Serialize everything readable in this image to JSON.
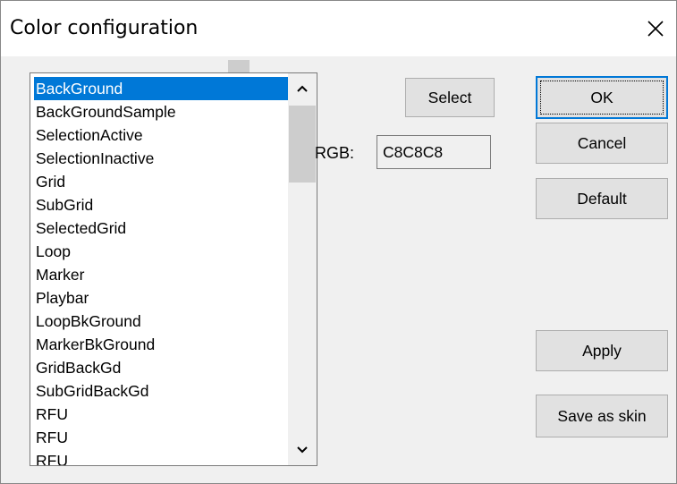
{
  "window": {
    "title": "Color configuration"
  },
  "list": {
    "items": [
      "BackGround",
      "BackGroundSample",
      "SelectionActive",
      "SelectionInactive",
      "Grid",
      "SubGrid",
      "SelectedGrid",
      "Loop",
      "Marker",
      "Playbar",
      "LoopBkGround",
      "MarkerBkGround",
      "GridBackGd",
      "SubGridBackGd",
      "RFU",
      "RFU",
      "RFU"
    ],
    "selected_index": 0
  },
  "rgb": {
    "label": "RGB:",
    "value": "C8C8C8"
  },
  "buttons": {
    "select": "Select",
    "ok": "OK",
    "cancel": "Cancel",
    "default": "Default",
    "apply": "Apply",
    "save_as_skin": "Save as skin"
  },
  "icons": {
    "close": "close-icon",
    "scroll_up": "chevron-up-icon",
    "scroll_down": "chevron-down-icon"
  },
  "colors": {
    "selection": "#0078d7",
    "dialog_bg": "#f0f0f0",
    "button_bg": "#e1e1e1"
  }
}
